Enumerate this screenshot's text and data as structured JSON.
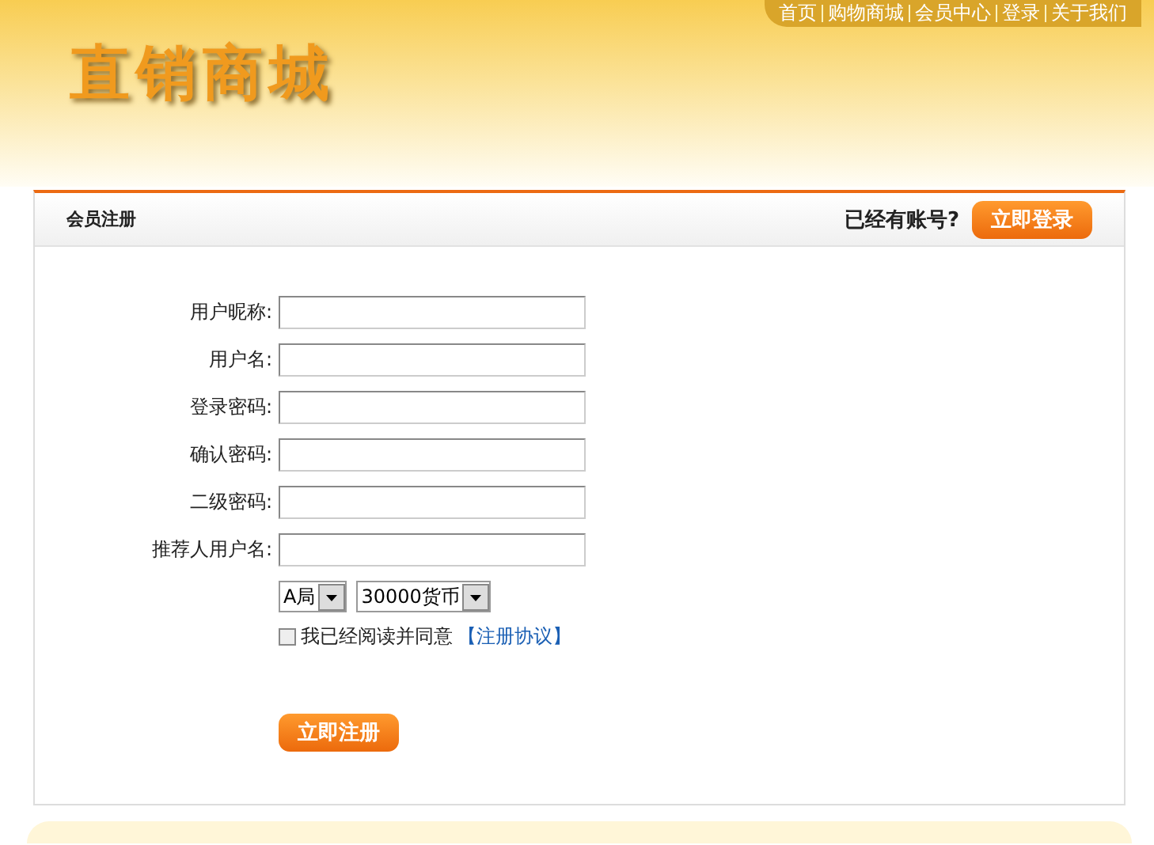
{
  "logo": "直销商城",
  "nav": [
    "首页",
    "购物商城",
    "会员中心",
    "登录",
    "关于我们"
  ],
  "panel": {
    "title": "会员注册",
    "login_prompt": "已经有账号?",
    "login_button": "立即登录"
  },
  "fields": [
    {
      "label": "用户昵称:"
    },
    {
      "label": "用户名:"
    },
    {
      "label": "登录密码:"
    },
    {
      "label": "确认密码:"
    },
    {
      "label": "二级密码:"
    },
    {
      "label": "推荐人用户名:"
    }
  ],
  "selects": [
    {
      "value": "A局"
    },
    {
      "value": "30000货币"
    }
  ],
  "agreement": {
    "checked": false,
    "text": "我已经阅读并同意",
    "link": "【注册协议】"
  },
  "submit": "立即注册"
}
